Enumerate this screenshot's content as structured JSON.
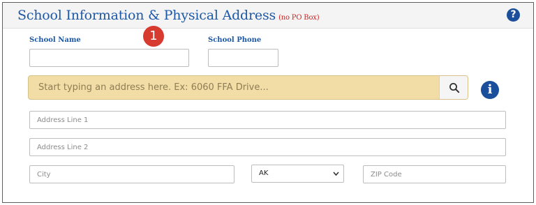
{
  "header": {
    "title": "School Information & Physical Address",
    "title_note": "(no PO Box)",
    "help_icon": "question-circle-icon",
    "help_symbol": "?"
  },
  "school": {
    "name_label": "School Name",
    "name_value": "",
    "phone_label": "School Phone",
    "phone_value": ""
  },
  "marker": {
    "number": "1",
    "color": "#d73a2e"
  },
  "address_search": {
    "placeholder": "Start typing an address here. Ex: 6060 FFA Drive...",
    "button_icon": "search-icon",
    "background_color": "#f1dda5"
  },
  "info": {
    "icon": "info-circle-icon",
    "symbol": "i"
  },
  "address": {
    "line1_placeholder": "Address Line 1",
    "line2_placeholder": "Address Line 2",
    "city_placeholder": "City",
    "state_selected": "AK",
    "zip_placeholder": "ZIP Code"
  },
  "colors": {
    "accent": "#1d58a6",
    "icon_blue": "#1b4f9c",
    "note_red": "#d42121"
  }
}
